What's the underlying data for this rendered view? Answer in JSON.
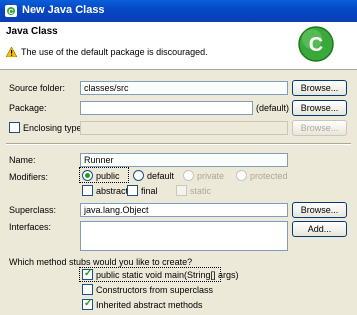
{
  "window": {
    "title": "New Java Class",
    "icon": "java-class-wizard-icon"
  },
  "banner": {
    "heading": "Java Class",
    "warning": "The use of the default package is discouraged.",
    "warning_icon": "warning-triangle-icon",
    "logo_icon": "eclipse-class-c-logo"
  },
  "form": {
    "source_folder": {
      "label": "Source folder:",
      "value": "classes/src",
      "button": "Browse..."
    },
    "package": {
      "label": "Package:",
      "value": "",
      "hint": "(default)",
      "button": "Browse..."
    },
    "enclosing_type": {
      "label": "Enclosing type:",
      "value": "",
      "button": "Browse...",
      "checked": false
    },
    "name": {
      "label": "Name:",
      "value": "Runner"
    },
    "modifiers": {
      "label": "Modifiers:",
      "public": "public",
      "default": "default",
      "private": "private",
      "protected": "protected",
      "abstract": "abstract",
      "final": "final",
      "static": "static",
      "selected": "public"
    },
    "superclass": {
      "label": "Superclass:",
      "value": "java.lang.Object",
      "button": "Browse..."
    },
    "interfaces": {
      "label": "Interfaces:",
      "button": "Add..."
    },
    "stubs": {
      "question": "Which method stubs would you like to create?",
      "main": "public static void main(String[] args)",
      "constructors": "Constructors from superclass",
      "inherited": "Inherited abstract methods",
      "main_checked": true,
      "constructors_checked": false,
      "inherited_checked": true
    }
  },
  "colors": {
    "title_bar": "#0548c7",
    "accent": "#21a121",
    "logo": "#3aa83a"
  }
}
